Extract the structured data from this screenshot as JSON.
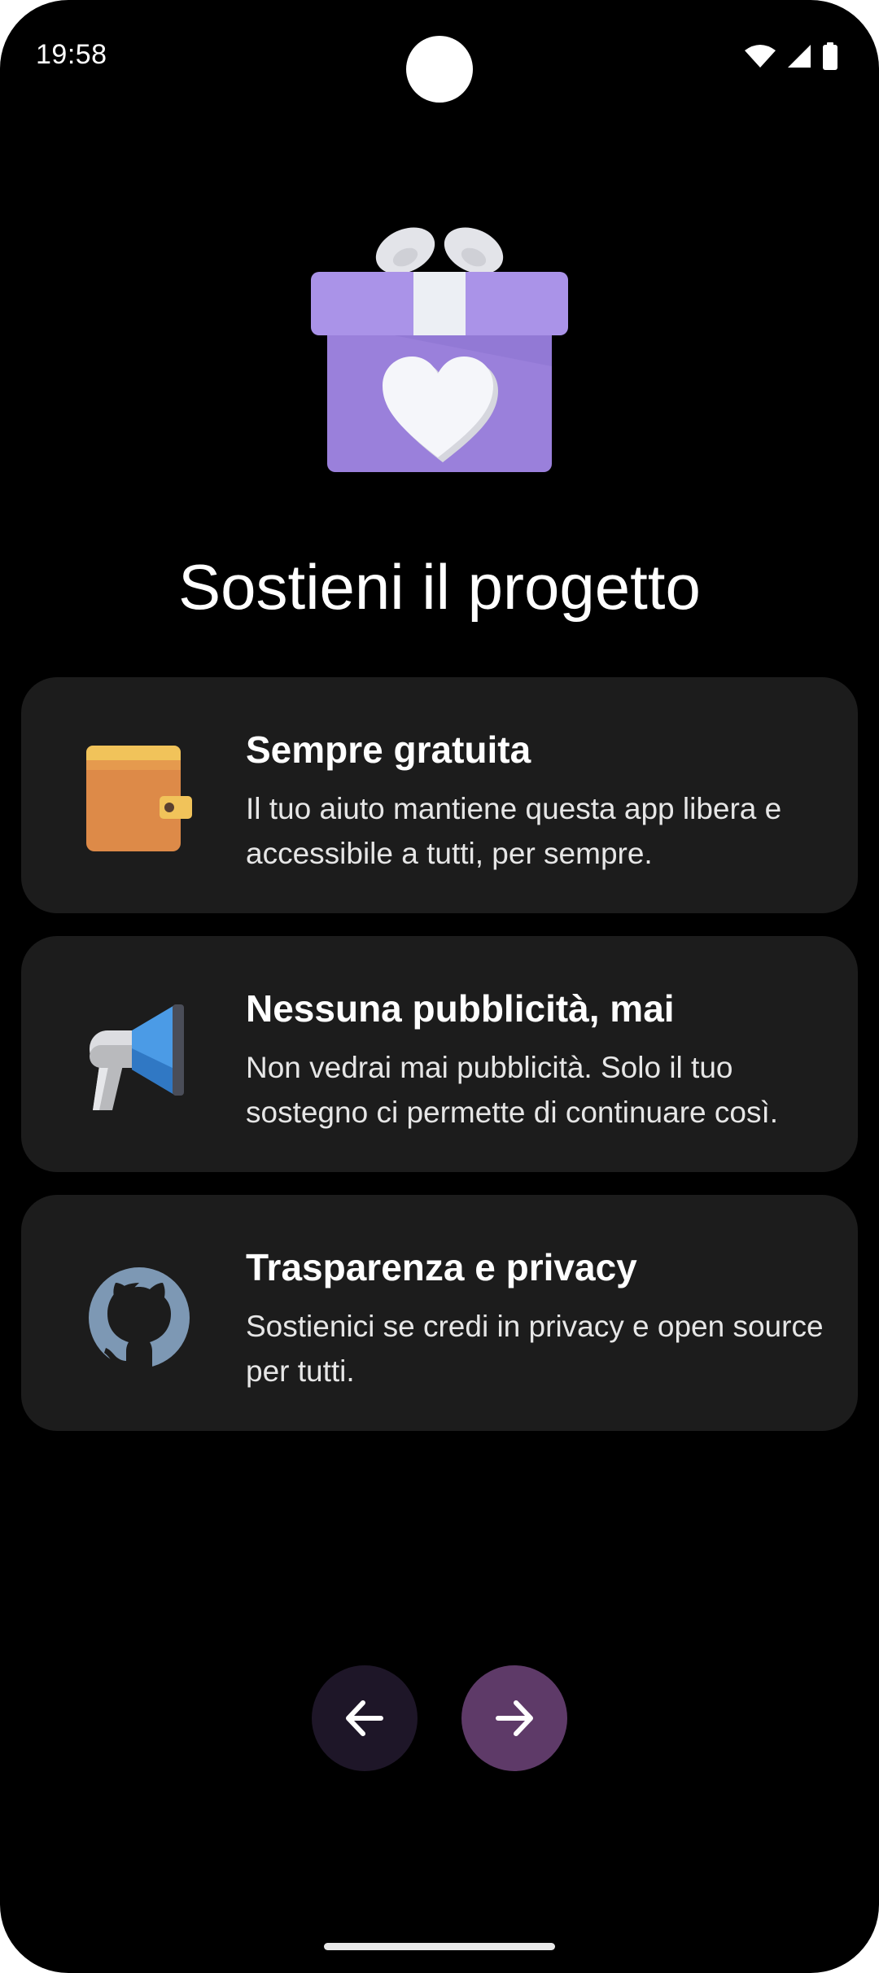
{
  "status_bar": {
    "time": "19:58"
  },
  "title": "Sostieni il progetto",
  "cards": [
    {
      "heading": "Sempre gratuita",
      "description": "Il tuo aiuto mantiene questa app libera e accessibile a tutti, per sempre.",
      "icon": "wallet-icon"
    },
    {
      "heading": "Nessuna pubblicità, mai",
      "description": "Non vedrai mai pubblicità. Solo il tuo sostegno ci permette di continuare così.",
      "icon": "megaphone-icon"
    },
    {
      "heading": "Trasparenza e privacy",
      "description": "Sostienici se credi in privacy e open source per tutti.",
      "icon": "github-icon"
    }
  ],
  "navigation": {
    "back_icon": "arrow-left-icon",
    "next_icon": "arrow-right-icon"
  },
  "colors": {
    "background": "#000000",
    "card": "#1c1c1c",
    "back_button": "#1e1628",
    "next_button": "#5e3a68",
    "gift_purple": "#9c83e0"
  }
}
